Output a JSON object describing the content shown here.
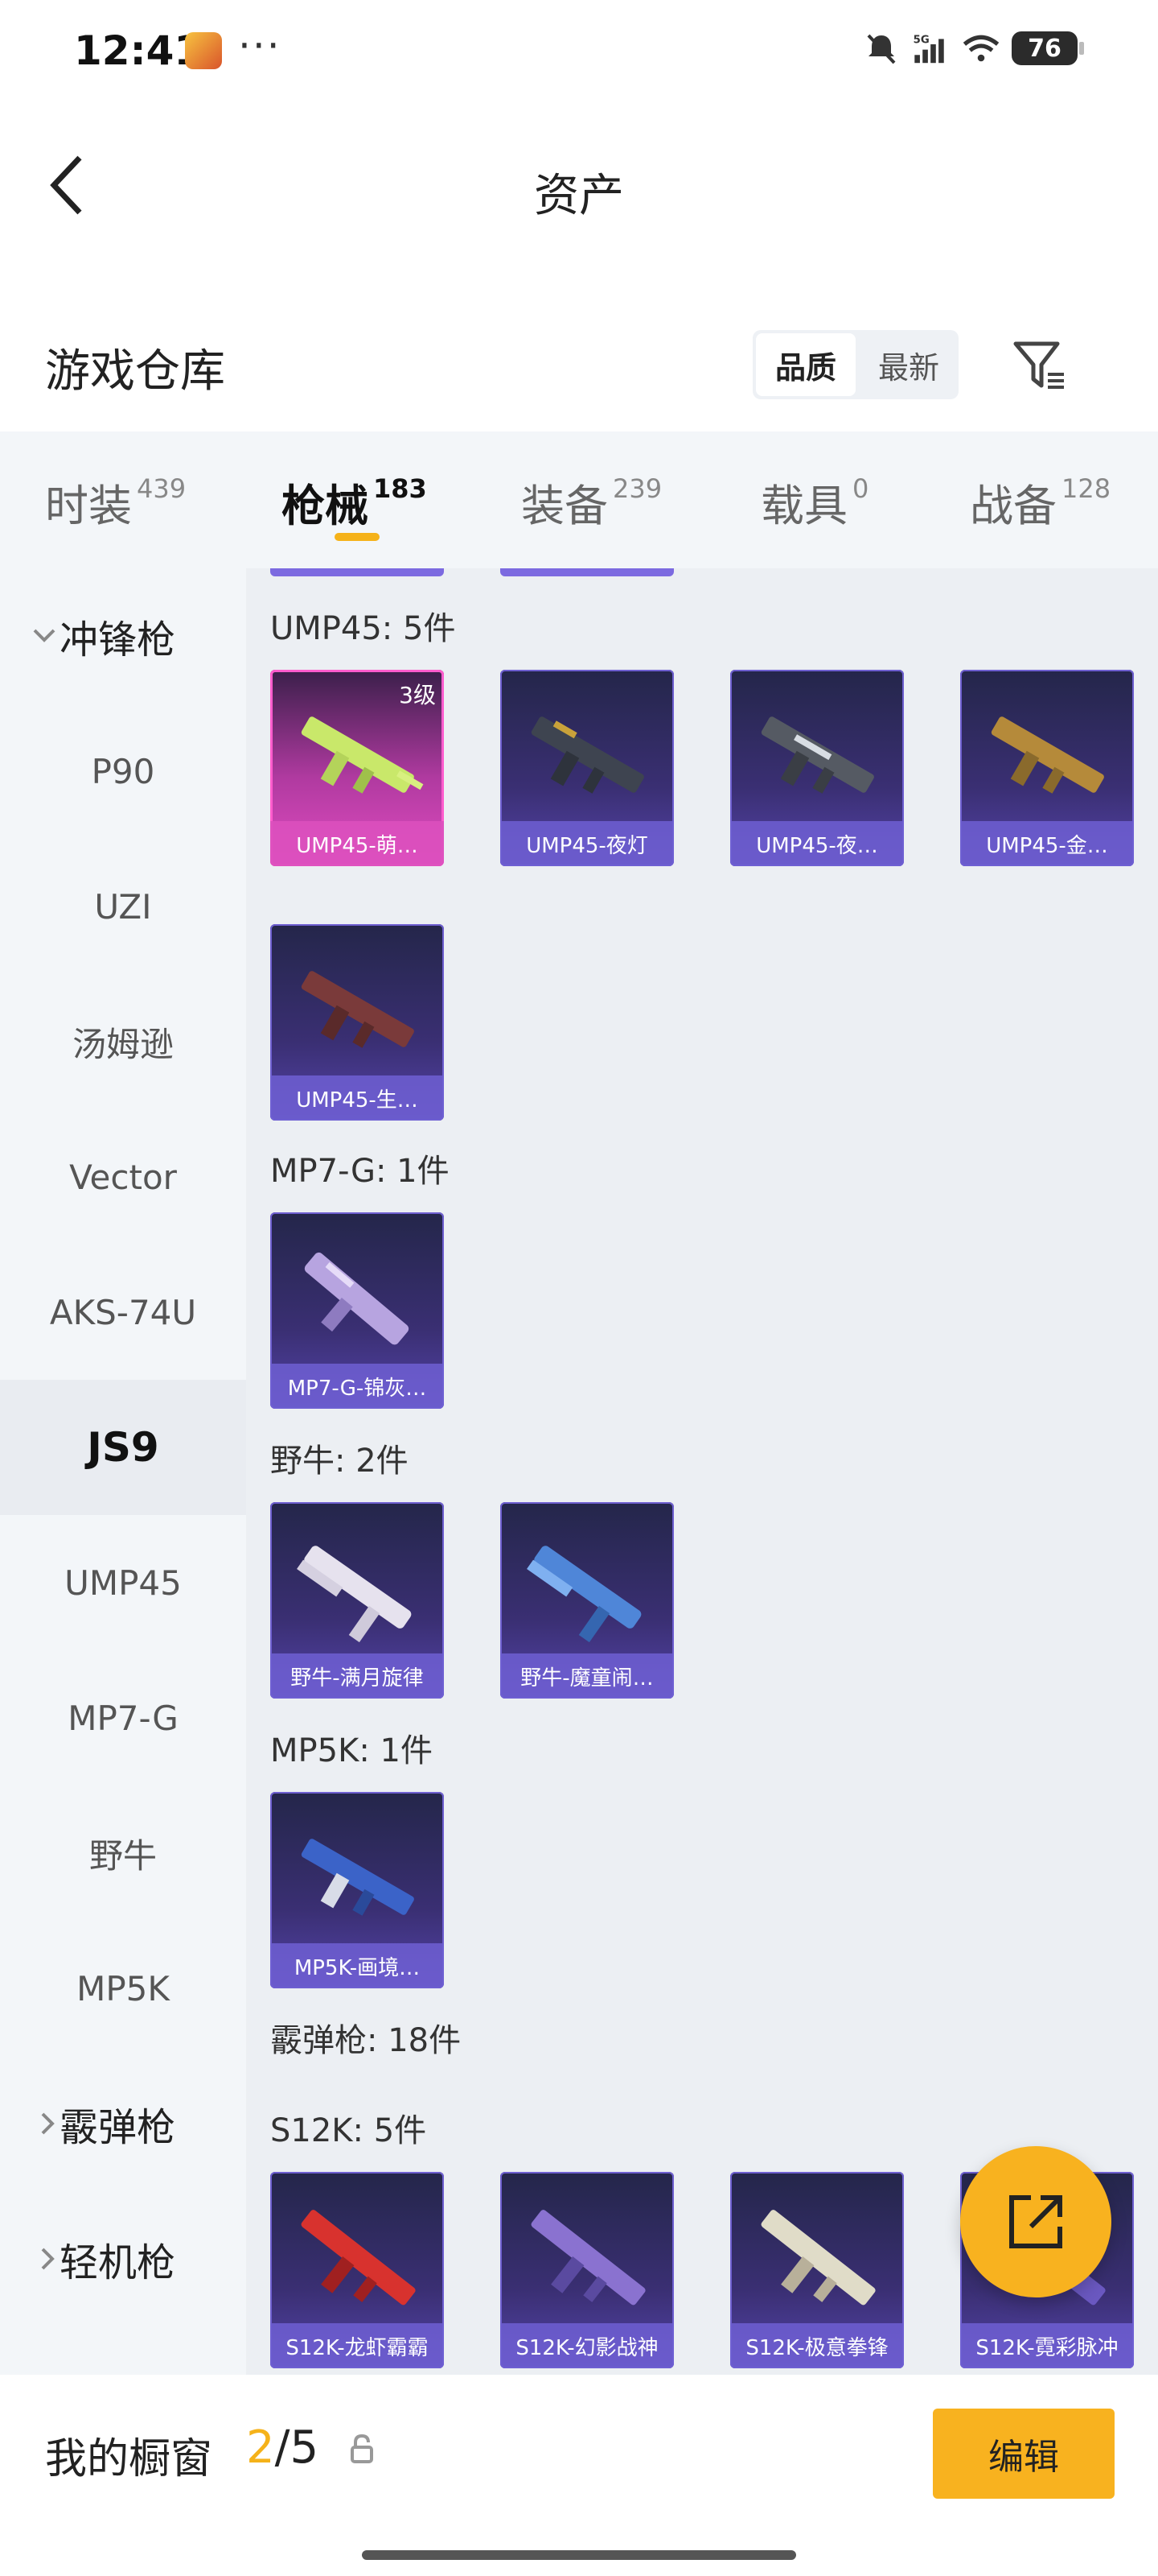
{
  "status_bar": {
    "time": "12:41",
    "dots": "···",
    "network": "5G",
    "battery": "76"
  },
  "header": {
    "title": "资产"
  },
  "warehouse": {
    "title": "游戏仓库",
    "sort_options": [
      "品质",
      "最新"
    ],
    "active_sort": "品质"
  },
  "tabs": [
    {
      "label": "时装",
      "count": "439"
    },
    {
      "label": "枪械",
      "count": "183",
      "active": true
    },
    {
      "label": "装备",
      "count": "239"
    },
    {
      "label": "载具",
      "count": "0"
    },
    {
      "label": "战备",
      "count": "128"
    }
  ],
  "sidebar": {
    "group_open": "冲锋枪",
    "items": [
      "P90",
      "UZI",
      "汤姆逊",
      "Vector",
      "AKS-74U",
      "JS9",
      "UMP45",
      "MP7-G",
      "野牛",
      "MP5K"
    ],
    "active_item": "JS9",
    "groups_closed": [
      "霰弹枪",
      "轻机枪"
    ]
  },
  "content": {
    "sections": [
      {
        "title": "UMP45: 5件",
        "items": [
          {
            "label": "UMP45-萌…",
            "level": "3级",
            "rarity": "pink"
          },
          {
            "label": "UMP45-夜灯"
          },
          {
            "label": "UMP45-夜…"
          },
          {
            "label": "UMP45-金…"
          },
          {
            "label": "UMP45-生…"
          }
        ]
      },
      {
        "title": "MP7-G: 1件",
        "items": [
          {
            "label": "MP7-G-锦灰…"
          }
        ]
      },
      {
        "title": "野牛: 2件",
        "items": [
          {
            "label": "野牛-满月旋律"
          },
          {
            "label": "野牛-魔童闹…"
          }
        ]
      },
      {
        "title": "MP5K: 1件",
        "items": [
          {
            "label": "MP5K-画境…"
          }
        ]
      },
      {
        "title": "霰弹枪: 18件",
        "items": []
      },
      {
        "title": "S12K: 5件",
        "items": [
          {
            "label": "S12K-龙虾霸霸"
          },
          {
            "label": "S12K-幻影战神"
          },
          {
            "label": "S12K-极意拳锋"
          },
          {
            "label": "S12K-霓彩脉冲"
          }
        ]
      }
    ]
  },
  "bottom_bar": {
    "title": "我的橱窗",
    "current": "2",
    "separator": "/",
    "total": "5",
    "edit_label": "编辑"
  },
  "colors": {
    "accent": "#f8b21f",
    "card_purple": "#5443a8",
    "card_pink": "#e04cc0"
  }
}
